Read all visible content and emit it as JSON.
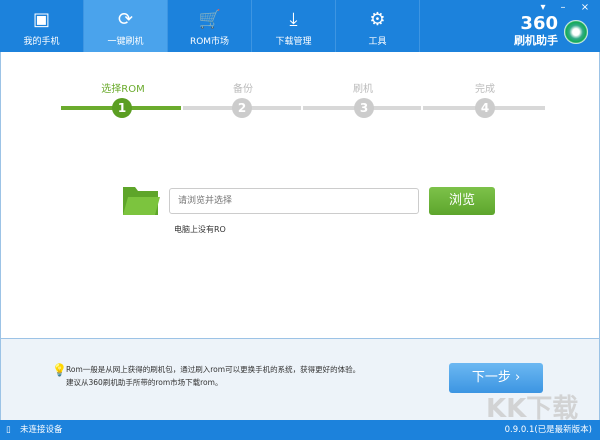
{
  "nav": {
    "tabs": [
      {
        "label": "我的手机",
        "icon": "phone-icon"
      },
      {
        "label": "一键刷机",
        "icon": "flash-icon"
      },
      {
        "label": "ROM市场",
        "icon": "cart-icon"
      },
      {
        "label": "下载管理",
        "icon": "download-icon"
      },
      {
        "label": "工具",
        "icon": "toolbox-icon"
      }
    ],
    "active": 1
  },
  "logo": {
    "number": "360",
    "title": "刷机助手"
  },
  "window": {
    "menu": "▾",
    "minimize": "–",
    "close": "×"
  },
  "steps": [
    {
      "label": "选择ROM",
      "num": "1"
    },
    {
      "label": "备份",
      "num": "2"
    },
    {
      "label": "刷机",
      "num": "3"
    },
    {
      "label": "完成",
      "num": "4"
    }
  ],
  "rom": {
    "placeholder": "请浏览并选择",
    "browse": "浏览",
    "hint": "电脑上没有RO"
  },
  "tips": {
    "line1": "Rom一般是从网上获得的刷机包，通过刷入rom可以更换手机的系统，获得更好的体验。",
    "line2": "建议从360刷机助手所带的rom市场下载rom。"
  },
  "next": "下一步",
  "next_arrow": "›",
  "watermark": "KK下载",
  "status": {
    "device": "未连接设备",
    "version": "0.9.0.1(已是最新版本)"
  },
  "colors": {
    "primary": "#1c82dc",
    "accent": "#6bab2d"
  }
}
